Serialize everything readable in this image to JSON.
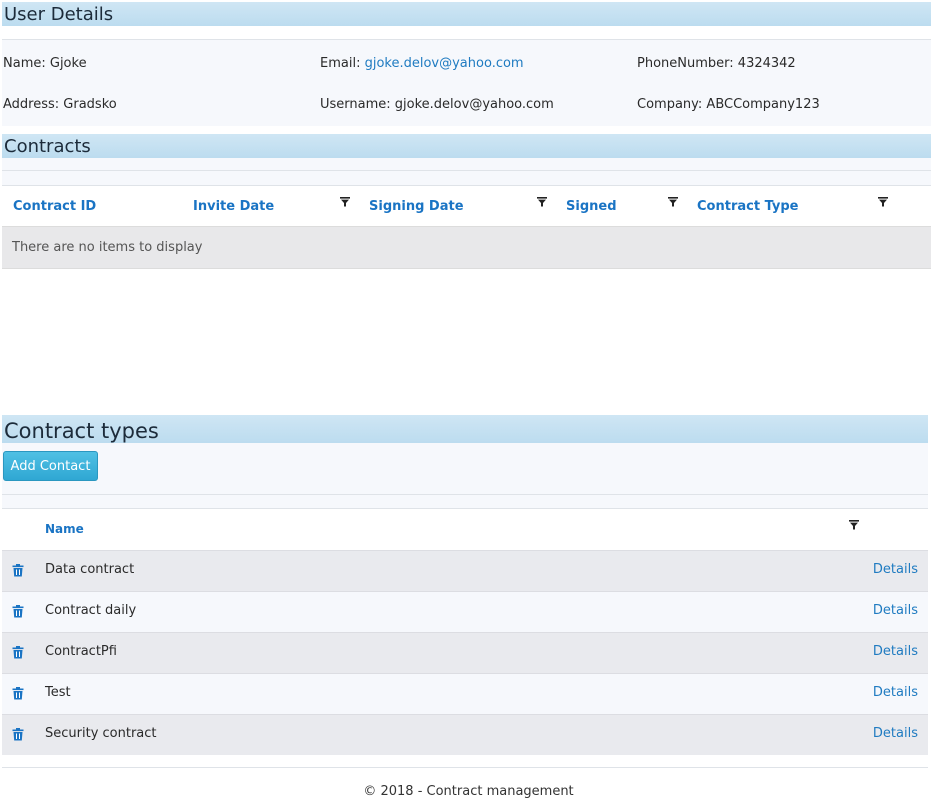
{
  "user_details": {
    "title": "User Details",
    "name_label": "Name:",
    "name_value": "Gjoke",
    "email_label": "Email:",
    "email_value": "gjoke.delov@yahoo.com",
    "phone_label": "PhoneNumber:",
    "phone_value": "4324342",
    "address_label": "Address:",
    "address_value": "Gradsko",
    "username_label": "Username:",
    "username_value": "gjoke.delov@yahoo.com",
    "company_label": "Company:",
    "company_value": "ABCCompany123"
  },
  "contracts": {
    "title": "Contracts",
    "columns": [
      "Contract ID",
      "Invite Date",
      "Signing Date",
      "Signed",
      "Contract Type"
    ],
    "empty_message": "There are no items to display"
  },
  "contract_types": {
    "title": "Contract types",
    "add_button_label": "Add Contact",
    "column_name": "Name",
    "details_label": "Details",
    "rows": [
      {
        "name": "Data contract"
      },
      {
        "name": "Contract daily"
      },
      {
        "name": "ContractPfi"
      },
      {
        "name": "Test"
      },
      {
        "name": "Security contract"
      }
    ]
  },
  "footer": {
    "text": "© 2018 - Contract management"
  },
  "colors": {
    "header_bg": "#c9e3f3",
    "link": "#1f7bc1",
    "column_header": "#1a74c4",
    "button": "#3ab2dc"
  },
  "icons": {
    "filter": "filter-icon",
    "delete": "trash-icon"
  }
}
